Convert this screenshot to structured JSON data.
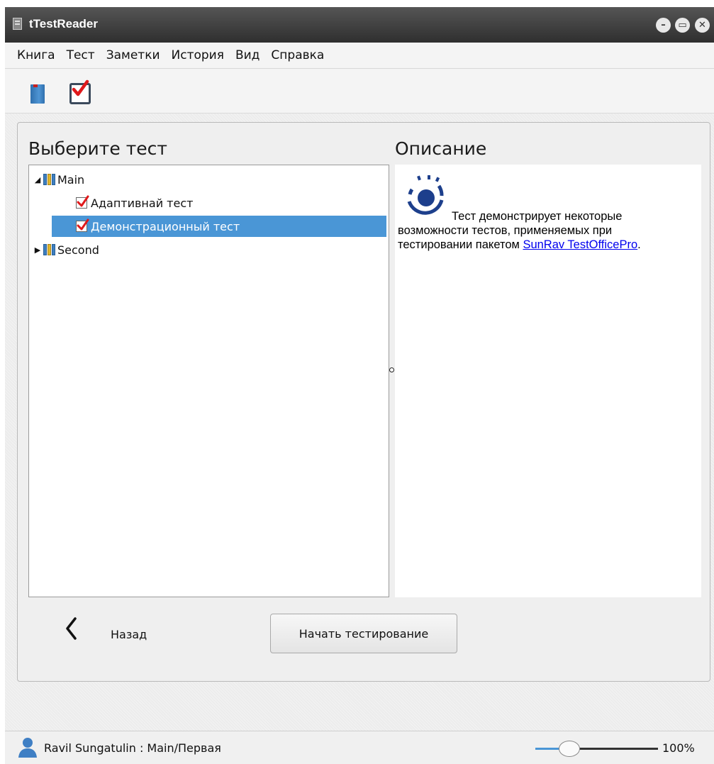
{
  "window": {
    "title": "tTestReader"
  },
  "menu": [
    "Книга",
    "Тест",
    "Заметки",
    "История",
    "Вид",
    "Справка"
  ],
  "toolbar": {
    "icons": [
      "book-icon",
      "checkbox-icon"
    ]
  },
  "left_panel": {
    "heading": "Выберите тест",
    "tree": [
      {
        "label": "Main",
        "expanded": true,
        "icon": "folder-icon"
      },
      {
        "label": "Адаптивнай тест",
        "icon": "test-checkbox-icon"
      },
      {
        "label": "Демонстрационный тест",
        "icon": "test-checkbox-icon",
        "selected": true
      },
      {
        "label": "Second",
        "expanded": false,
        "icon": "folder-icon"
      }
    ]
  },
  "right_panel": {
    "heading": "Описание",
    "description_line1": "Тест демонстрирует некоторые",
    "description_line2": "возможности тестов, применяемых при",
    "description_line3": "тестировании пакетом ",
    "link_text": "SunRav TestOfficePro",
    "link_suffix": "."
  },
  "actions": {
    "back_label": "Назад",
    "start_label": "Начать тестирование"
  },
  "status": {
    "user_path": "Ravil Sungatulin : Main/Первая",
    "zoom_text": "100%",
    "zoom_slider_fraction": 0.27
  },
  "colors": {
    "titlebar": "#3a3a3a",
    "selection": "#4a96d6",
    "link": "#0000ee",
    "check_red": "#e0191b"
  }
}
